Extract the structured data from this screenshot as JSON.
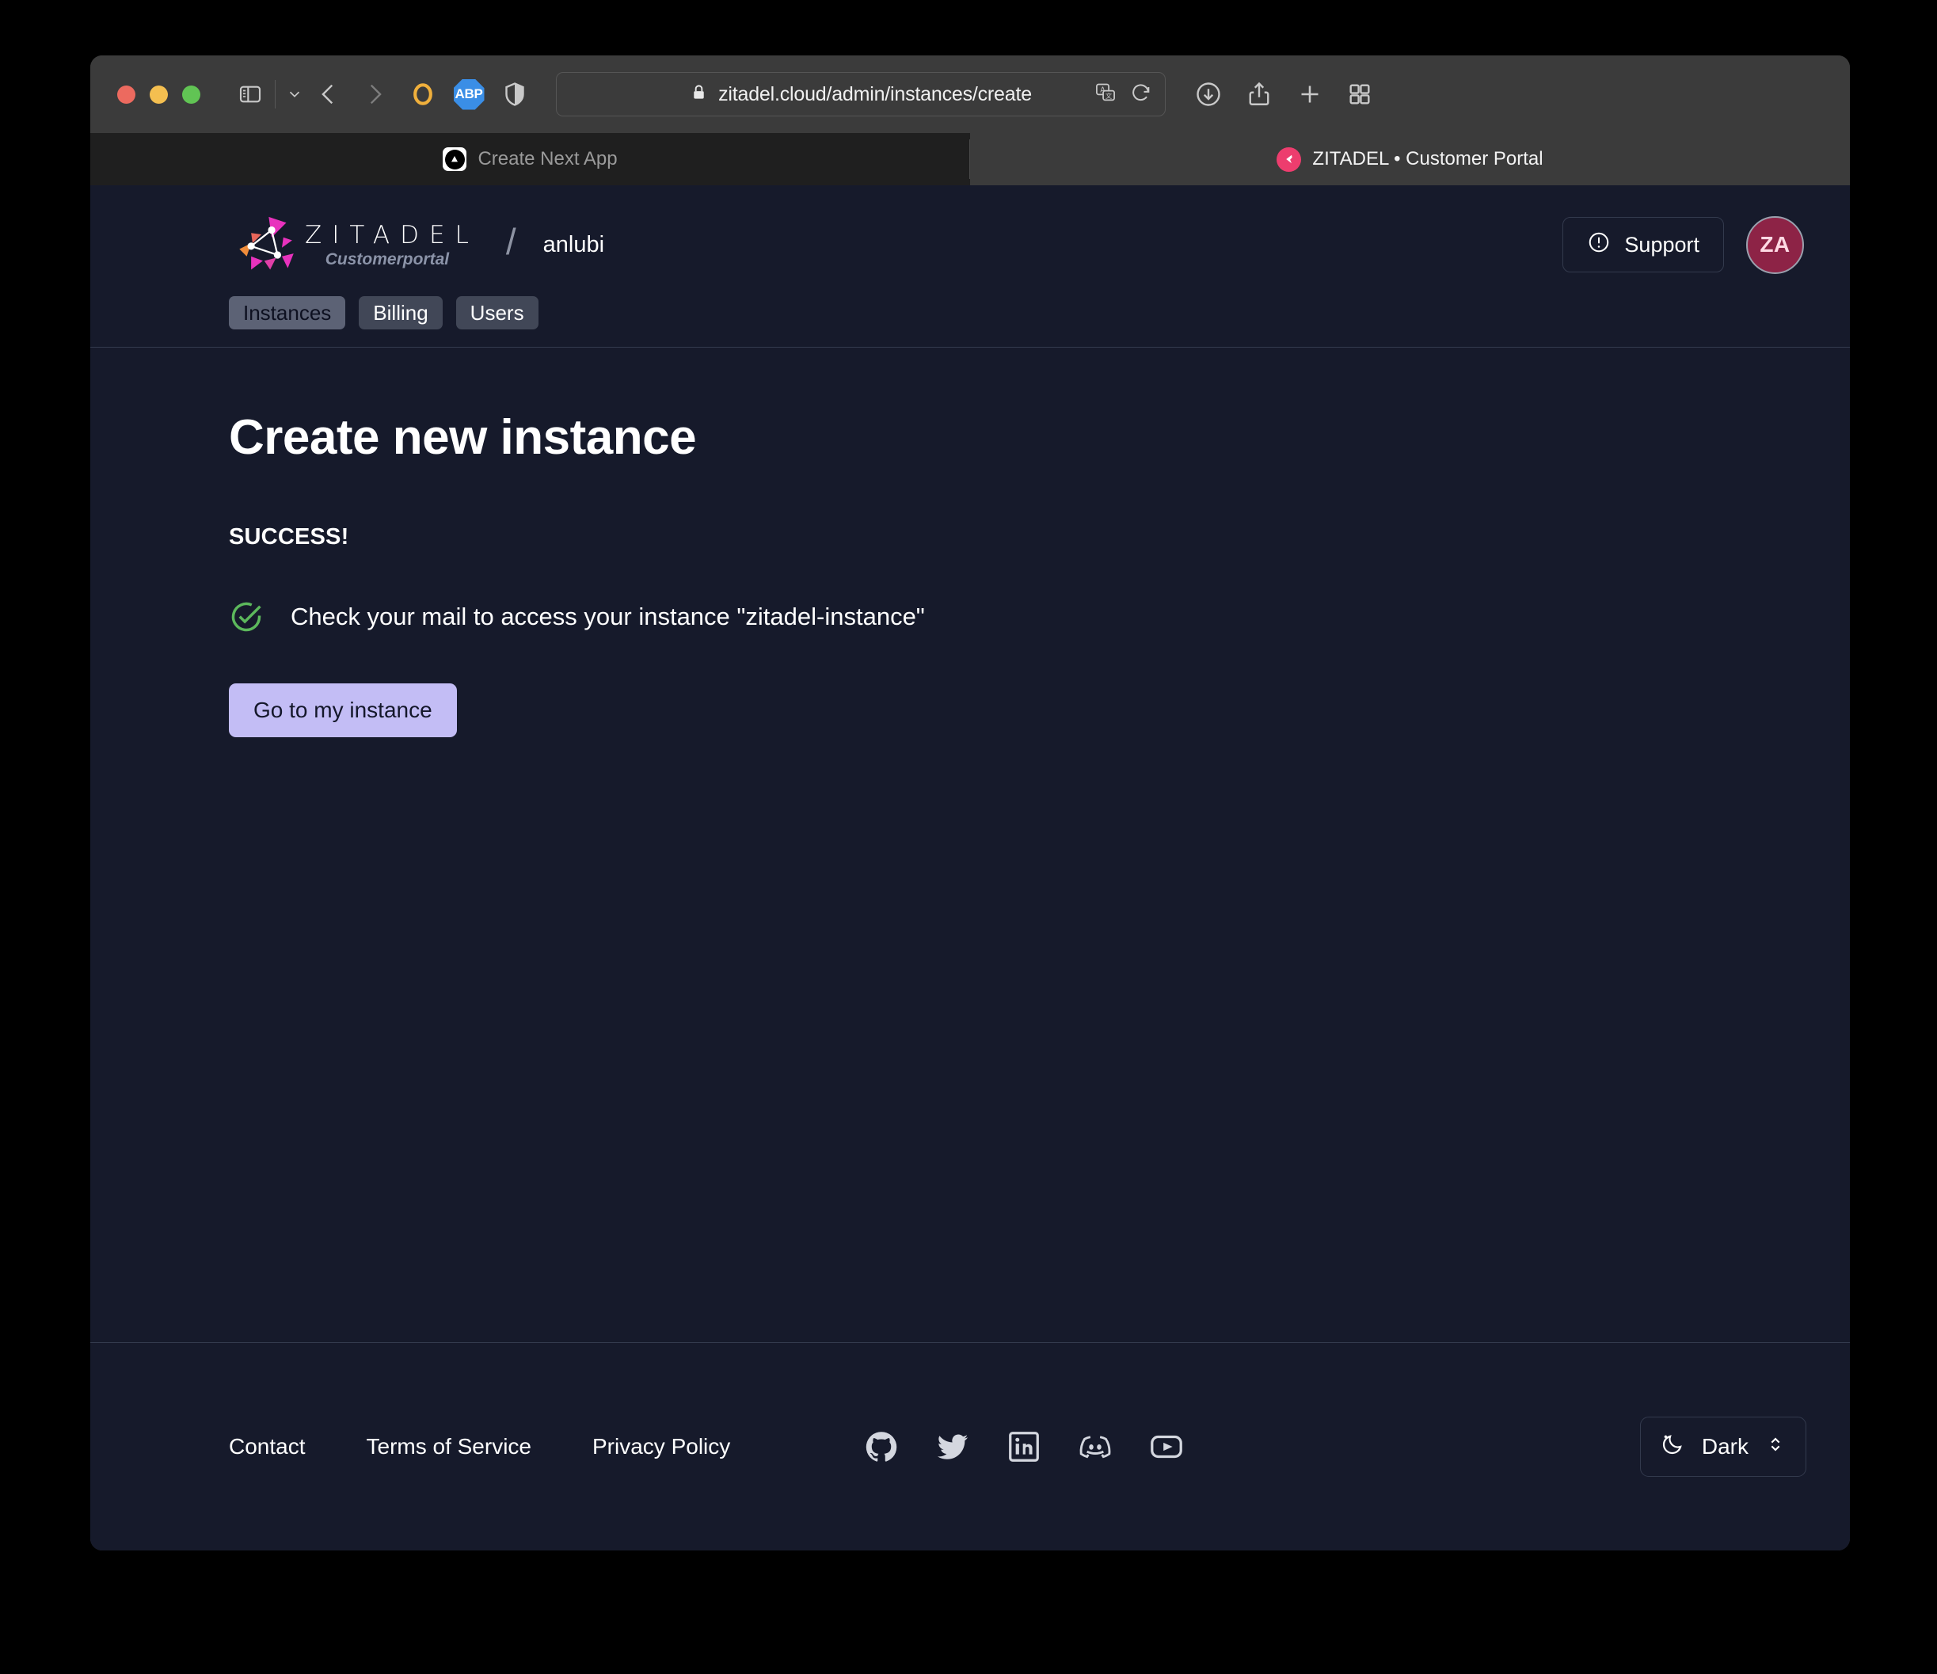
{
  "browser": {
    "window_controls": [
      "close",
      "minimize",
      "maximize"
    ],
    "url": "zitadel.cloud/admin/instances/create",
    "toolbar_icons": [
      "sidebar-toggle-icon",
      "chevron-down-icon",
      "back-arrow-icon",
      "forward-arrow-icon",
      "extension-ring-icon",
      "adblock-plus-icon",
      "shield-icon",
      "lock-icon",
      "translate-icon",
      "reload-icon",
      "downloads-icon",
      "share-icon",
      "new-tab-icon",
      "tab-overview-icon"
    ],
    "adblock_label": "ABP",
    "tabs": [
      {
        "title": "Create Next App",
        "active": false,
        "favicon": "nextjs-icon"
      },
      {
        "title": "ZITADEL • Customer Portal",
        "active": true,
        "favicon": "zitadel-icon"
      }
    ]
  },
  "header": {
    "logo_wordmark": "ZITADEL",
    "logo_subtitle": "Customerportal",
    "separator": "/",
    "org_name": "anlubi",
    "support_label": "Support",
    "avatar_initials": "ZA",
    "nav": [
      {
        "label": "Instances",
        "active": true
      },
      {
        "label": "Billing",
        "active": false
      },
      {
        "label": "Users",
        "active": false
      }
    ]
  },
  "main": {
    "title": "Create new instance",
    "success_label": "SUCCESS!",
    "success_message": "Check your mail to access your instance \"zitadel-instance\"",
    "cta_label": "Go to my instance"
  },
  "footer": {
    "links": [
      "Contact",
      "Terms of Service",
      "Privacy Policy"
    ],
    "social": [
      "github-icon",
      "twitter-icon",
      "linkedin-icon",
      "discord-icon",
      "youtube-icon"
    ],
    "theme_label": "Dark"
  },
  "colors": {
    "page_background": "#161a2b",
    "accent_button": "#c3bdf5",
    "success_green": "#5cb85c",
    "avatar_background": "#8d2346",
    "brand_pink": "#ed3d6e",
    "brand_orange": "#f08c3a",
    "nav_active": "#5c6275",
    "nav_idle": "#414757"
  }
}
